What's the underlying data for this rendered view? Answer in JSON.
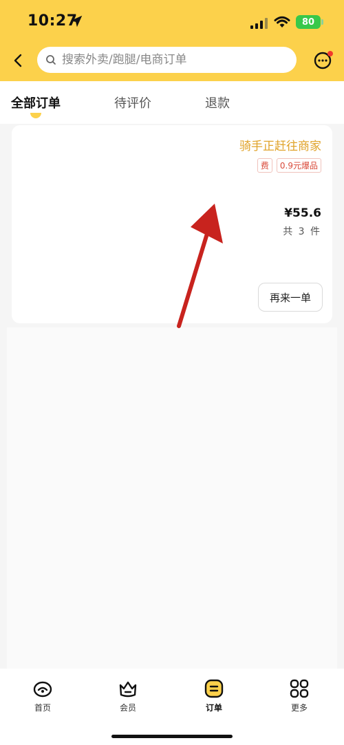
{
  "status_bar": {
    "time": "10:27",
    "battery": "80"
  },
  "search": {
    "placeholder": "搜索外卖/跑腿/电商订单"
  },
  "tabs": [
    {
      "label": "全部订单",
      "active": true
    },
    {
      "label": "待评价",
      "active": false
    },
    {
      "label": "退款",
      "active": false
    }
  ],
  "order": {
    "status": "骑手正赶往商家",
    "tags": [
      "费",
      "0.9元爆品"
    ],
    "price": "¥55.6",
    "count": "共 3 件",
    "reorder_label": "再来一单"
  },
  "bottom_nav": [
    {
      "label": "首页",
      "icon": "home-icon",
      "active": false
    },
    {
      "label": "会员",
      "icon": "member-icon",
      "active": false
    },
    {
      "label": "订单",
      "icon": "orders-icon",
      "active": true
    },
    {
      "label": "更多",
      "icon": "more-icon",
      "active": false
    }
  ],
  "colors": {
    "brand_yellow": "#fcd14b",
    "status_orange": "#e0a32a",
    "tag_red": "#d94a3a",
    "annotation_red": "#c8231e"
  }
}
